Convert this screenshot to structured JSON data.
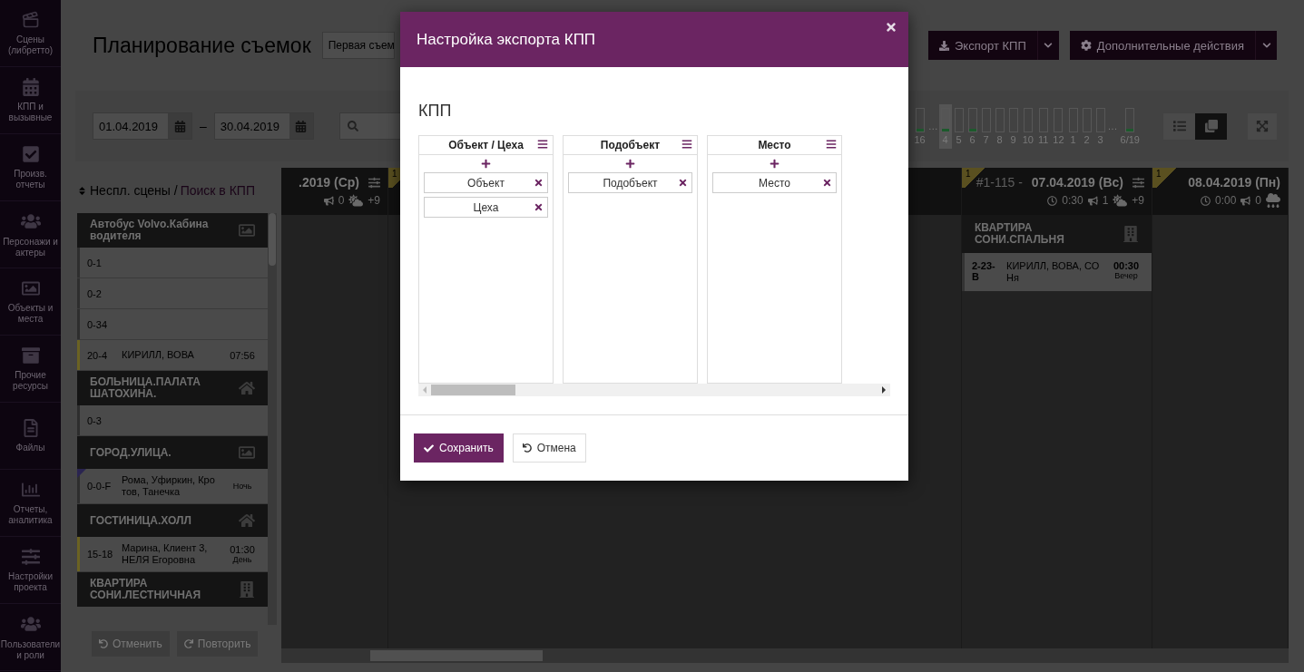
{
  "sidebar": {
    "items": [
      {
        "label": "Сцены (либретто)"
      },
      {
        "label": "КПП и вызывные"
      },
      {
        "label": "Произв. отчеты"
      },
      {
        "label": "Персонажи и актеры"
      },
      {
        "label": "Объекты и места"
      },
      {
        "label": "Прочие ресурсы"
      },
      {
        "label": "Файлы"
      },
      {
        "label": "Отчеты, аналитика"
      },
      {
        "label": "Настройки проекта"
      },
      {
        "label": "Пользователи и роли"
      }
    ]
  },
  "header": {
    "title": "Планирование съемок",
    "select_value": "Первая съем",
    "actions": [
      {
        "label": "Экспорт КПП"
      },
      {
        "label": "Дополнительные действия"
      }
    ]
  },
  "toolbar": {
    "date_from": "01.04.2019",
    "separator": "–",
    "date_to": "30.04.2019",
    "days": [
      {
        "kind": "day",
        "label": "16",
        "filled": true,
        "selected": false
      },
      {
        "kind": "gap",
        "label": "…"
      },
      {
        "kind": "day",
        "label": "4",
        "filled": true,
        "selected": true
      },
      {
        "kind": "day",
        "label": "5",
        "filled": false,
        "selected": false
      },
      {
        "kind": "day",
        "label": "6",
        "filled": true,
        "selected": false
      },
      {
        "kind": "day",
        "label": "7",
        "filled": false,
        "selected": false
      },
      {
        "kind": "day",
        "label": "8",
        "filled": false,
        "selected": false
      },
      {
        "kind": "day",
        "label": "9",
        "filled": false,
        "selected": false
      },
      {
        "kind": "day",
        "label": "10",
        "filled": false,
        "selected": false
      },
      {
        "kind": "day",
        "label": "11",
        "filled": false,
        "selected": false
      },
      {
        "kind": "day",
        "label": "12",
        "filled": false,
        "selected": false
      },
      {
        "kind": "day",
        "label": "1",
        "filled": false,
        "selected": false
      },
      {
        "kind": "day",
        "label": "2",
        "filled": false,
        "selected": false
      },
      {
        "kind": "day",
        "label": "3",
        "filled": false,
        "selected": false
      },
      {
        "kind": "gap",
        "label": "…"
      },
      {
        "kind": "day",
        "label": "6/19",
        "filled": true,
        "selected": false
      }
    ],
    "views": [
      {
        "kind": "list",
        "selected": false
      },
      {
        "kind": "cards",
        "selected": true
      }
    ]
  },
  "left_panel": {
    "title": "Неспл. сцены /",
    "link": "Поиск в КПП",
    "rows": [
      {
        "kind": "group",
        "title": "Автобус Volvo.Кабина водителя"
      },
      {
        "kind": "scene",
        "number": "0-1",
        "color": "#2e2e2e",
        "flag": false
      },
      {
        "kind": "scene",
        "number": "0-2",
        "color": "#2e2e2e",
        "flag": false
      },
      {
        "kind": "scene",
        "number": "0-34",
        "color": "#2e2e2e",
        "flag": false
      },
      {
        "kind": "scene",
        "number": "20-4",
        "cast": "КИРИЛЛ, ВОВА",
        "time": "07:56",
        "color": "#6b6222",
        "flag": false
      },
      {
        "kind": "group",
        "title": "БОЛЬНИЦА.ПАЛАТА ШАТОХИНА."
      },
      {
        "kind": "scene",
        "number": "0-3",
        "color": "#2e2e2e",
        "flag": false
      },
      {
        "kind": "group",
        "title": "ГОРОД.УЛИЦА."
      },
      {
        "kind": "scene",
        "number": "0-0-F",
        "cast": "Рома, Уфиркин, Кротов, Танечка",
        "daypart": "Ночь",
        "color": "#2e2e2e",
        "flag": true
      },
      {
        "kind": "group",
        "title": "ГОСТИНИЦА.ХОЛЛ"
      },
      {
        "kind": "scene",
        "number": "15-18",
        "cast": "Марина, Клиент 3, НЕЛЯ Егоровна",
        "time": "01:30",
        "daypart": "День",
        "color": "#6b6222",
        "flag": false
      },
      {
        "kind": "group",
        "title": "КВАРТИРА СОНИ.ЛЕСТНИЧНАЯ"
      }
    ],
    "buttons": [
      {
        "kind": "undo",
        "label": "Отменить"
      },
      {
        "kind": "redo",
        "label": "Повторить"
      }
    ]
  },
  "board": {
    "columns": [
      {
        "date": ".2019 (Ср)",
        "announcements": "0",
        "weather": "+9"
      },
      {
        "marker": "1"
      },
      {
        "marker": "1",
        "number": "#1-115 -",
        "date": "07.04.2019 (Вс)",
        "duration": "0:30",
        "announcements": "1",
        "weather": "+9",
        "groups": [
          {
            "title": "КВАРТИРА СОНИ.СПАЛЬНЯ",
            "scenes": [
              {
                "number": "2-23-В",
                "cast": "КИРИЛЛ, ВОВА, СОНя",
                "time": "00:30",
                "daypart": "Вечер"
              }
            ]
          }
        ]
      },
      {
        "marker": "1",
        "date": "08.04.2019 (Пн)",
        "duration": "0:00",
        "announcements": "0"
      }
    ]
  },
  "modal": {
    "title": "Настройка экспорта КПП",
    "heading": "КПП",
    "columns": [
      {
        "title": "Объект / Цеха",
        "items": [
          "Объект",
          "Цеха"
        ]
      },
      {
        "title": "Подобъект",
        "items": [
          "Подобъект"
        ]
      },
      {
        "title": "Место",
        "items": [
          "Место"
        ]
      }
    ],
    "buttons": [
      {
        "kind": "primary",
        "label": "Сохранить"
      },
      {
        "kind": "secondary",
        "label": "Отмена"
      }
    ]
  }
}
